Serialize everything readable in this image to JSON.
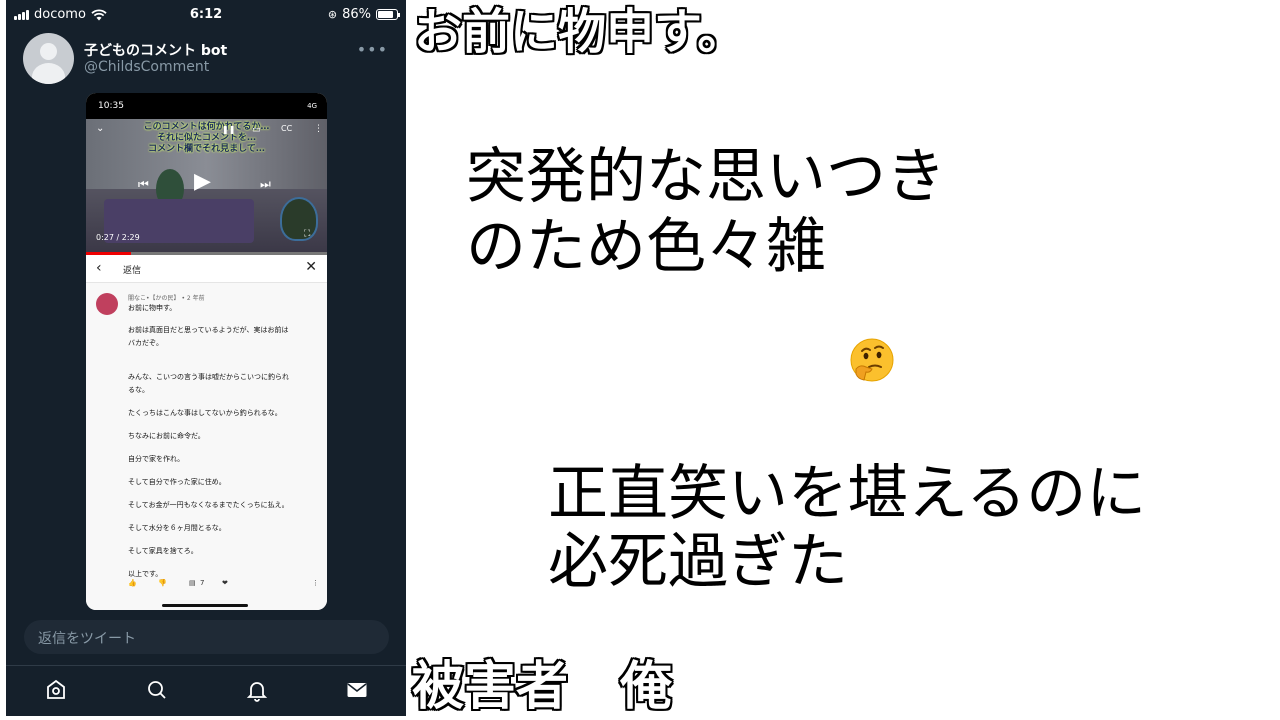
{
  "status_bar": {
    "carrier": "docomo",
    "time": "6:12",
    "battery": "86%"
  },
  "tweet": {
    "display_name": "子どものコメント bot",
    "handle": "@ChildsComment",
    "more": "•••"
  },
  "media": {
    "status_time": "10:35",
    "status_right": "4G",
    "video_caption_lines": [
      "このコメントは何かれてるか…",
      "それに似たコメントを…",
      "コメント欄でそれ見まして…"
    ],
    "video_time": "0:27 / 2:29",
    "progress": 0.185,
    "reply_label": "返信",
    "comment_meta": "闇なこ•【かの民】 • 2 年前",
    "comment_lines": [
      "お前に物申す。",
      "お前は真面目だと思っているようだが、実はお前は",
      "バカだぞ。",
      "みんな、こいつの言う事は嘘だからこいつに釣られ",
      "るな。",
      "たくっちはこんな事はしてないから釣られるな。",
      "ちなみにお前に命令だ。",
      "自分で家を作れ。",
      "そして自分で作った家に住め。",
      "そしてお金が一円もなくなるまでたくっちに払え。",
      "そして水分を６ヶ月間とるな。",
      "そして家具を捨てろ。",
      "以上です。"
    ],
    "reply_count": "7"
  },
  "reply_placeholder": "返信をツイート",
  "captions": {
    "top": "お前に物申す。",
    "middle_1": [
      "突発的な思いつき",
      "のため色々雑"
    ],
    "middle_2": [
      "正直笑いを堪えるのに",
      "必死過ぎた"
    ],
    "bottom": "被害者　俺"
  },
  "emoji": "thinking-face-emoji"
}
